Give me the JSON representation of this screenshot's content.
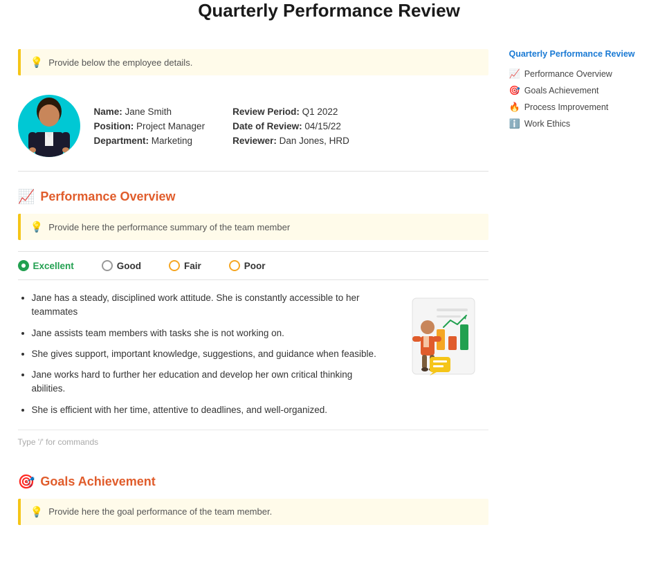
{
  "page": {
    "title": "Quarterly Performance Review"
  },
  "info_box_1": {
    "icon": "💡",
    "text": "Provide below the employee details."
  },
  "employee": {
    "name_label": "Name:",
    "name_value": "Jane Smith",
    "position_label": "Position:",
    "position_value": "Project Manager",
    "department_label": "Department:",
    "department_value": "Marketing",
    "review_period_label": "Review Period:",
    "review_period_value": "Q1 2022",
    "date_label": "Date of Review:",
    "date_value": "04/15/22",
    "reviewer_label": "Reviewer:",
    "reviewer_value": "Dan Jones, HRD"
  },
  "performance_section": {
    "icon": "📈",
    "title": "Performance Overview",
    "info_icon": "💡",
    "info_text": "Provide here the performance summary of the team member",
    "ratings": [
      {
        "label": "Excellent",
        "selected": true,
        "color": "green"
      },
      {
        "label": "Good",
        "selected": false,
        "color": "gray"
      },
      {
        "label": "Fair",
        "selected": false,
        "color": "yellow"
      },
      {
        "label": "Poor",
        "selected": false,
        "color": "orange"
      }
    ],
    "bullets": [
      "Jane has a steady, disciplined work attitude. She is constantly accessible to her teammates",
      "Jane assists team members with tasks she is not working on.",
      "She gives support, important knowledge, suggestions, and guidance when feasible.",
      "Jane works hard to further her education and develop her own critical thinking abilities.",
      "She is efficient with her time, attentive to deadlines, and well-organized."
    ],
    "command_hint": "Type '/' for commands"
  },
  "goals_section": {
    "icon": "🎯",
    "title": "Goals Achievement",
    "info_icon": "💡",
    "info_text": "Provide here the goal performance of the team member."
  },
  "sidebar": {
    "title": "Quarterly Performance Review",
    "items": [
      {
        "icon": "📈",
        "label": "Performance Overview"
      },
      {
        "icon": "🎯",
        "label": "Goals Achievement"
      },
      {
        "icon": "🔥",
        "label": "Process Improvement"
      },
      {
        "icon": "ℹ️",
        "label": "Work Ethics"
      }
    ]
  }
}
